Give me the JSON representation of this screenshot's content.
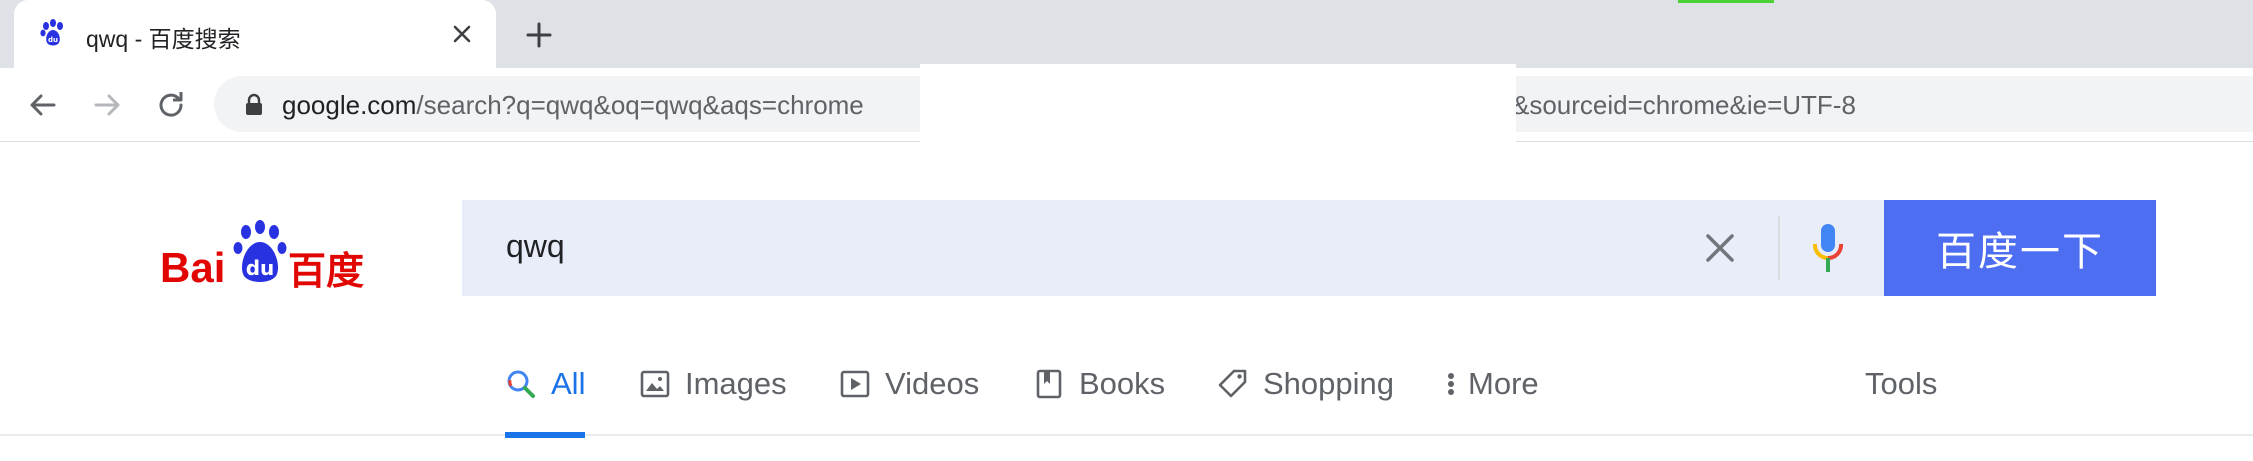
{
  "browser": {
    "tab": {
      "title": "qwq - 百度搜索",
      "favicon": "baidu-paw-icon"
    },
    "new_tab_icon": "plus-icon",
    "url_host": "google.com",
    "url_path_left": "/search?q=qwq&oq=qwq&aqs=chrome",
    "url_path_right": "&sourceid=chrome&ie=UTF-8"
  },
  "search": {
    "logo": "Baidu 百度",
    "query": "qwq",
    "submit_label": "百度一下",
    "accent": "#4e6ef2"
  },
  "nav": {
    "tabs": [
      {
        "label": "All",
        "icon": "search-icon",
        "active": true
      },
      {
        "label": "Images",
        "icon": "image-icon"
      },
      {
        "label": "Videos",
        "icon": "video-icon"
      },
      {
        "label": "Books",
        "icon": "book-icon"
      },
      {
        "label": "Shopping",
        "icon": "tag-icon"
      },
      {
        "label": "More",
        "icon": "more-vert-icon"
      }
    ],
    "tools_label": "Tools"
  }
}
